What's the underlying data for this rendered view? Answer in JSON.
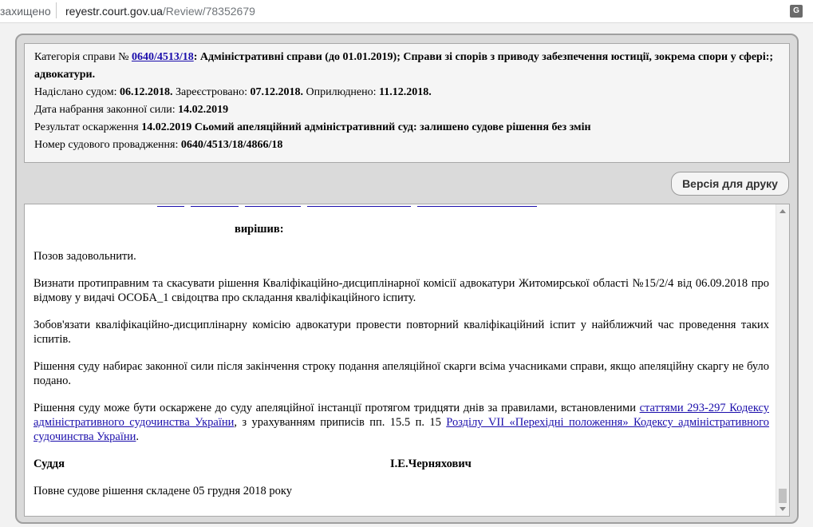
{
  "browser": {
    "security": "захищено",
    "url_host": "reyestr.court.gov.ua",
    "url_path": "/Review/78352679",
    "translate_icon": "translate-icon"
  },
  "info": {
    "category_label": "Категорія справи №",
    "case_link": "0640/4513/18",
    "category_text": ": Адміністративні справи (до 01.01.2019); Справи зі спорів з приводу забезпечення юстиції, зокрема спори у сфері:; адвокатури.",
    "sent_label": "Надіслано судом:",
    "sent_date": "06.12.2018.",
    "registered_label": "Зареєстровано:",
    "registered_date": "07.12.2018.",
    "published_label": "Оприлюднено:",
    "published_date": "11.12.2018.",
    "force_label": "Дата набрання законної сили:",
    "force_date": "14.02.2019",
    "appeal_label": "Результат оскарження",
    "appeal_text": "14.02.2019 Сьомий апеляційний адміністративний суд: залишено судове рішення без змін",
    "proceeding_label": "Номер судового провадження:",
    "proceeding_number": "0640/4513/18/4866/18"
  },
  "print_button": "Версія для друку",
  "document": {
    "heading": "вирішив:",
    "p1": "Позов задовольнити.",
    "p2": "Визнати протиправним та скасувати рішення Кваліфікаційно-дисциплінарної комісії адвокатури Житомирської області  №15/2/4 від 06.09.2018 про відмову у видачі ОСОБА_1 свідоцтва про складання кваліфікаційного іспиту.",
    "p3": "Зобов'язати кваліфікаційно-дисциплінарну комісію адвокатури провести повторний кваліфікаційний іспит у найближчий час проведення таких іспитів.",
    "p4": "Рішення суду набирає законної сили після закінчення строку подання апеляційної скарги всіма учасниками справи, якщо апеляційну скаргу не було подано.",
    "p5_a": "Рішення суду може бути оскаржене до суду апеляційної інстанції протягом тридцяти днів за правилами, встановленими ",
    "p5_link1": "статтями 293-297 Кодексу адміністративного судочинства України",
    "p5_b": ", з урахуванням приписів пп. 15.5 п. 15 ",
    "p5_link2": "Розділу VII «Перехідні положення» Кодексу адміністративного судочинства України",
    "p5_c": ".",
    "judge_label": "Суддя",
    "judge_name": "І.Е.Черняхович",
    "final": "Повне судове рішення складене 05 грудня 2018 року"
  }
}
